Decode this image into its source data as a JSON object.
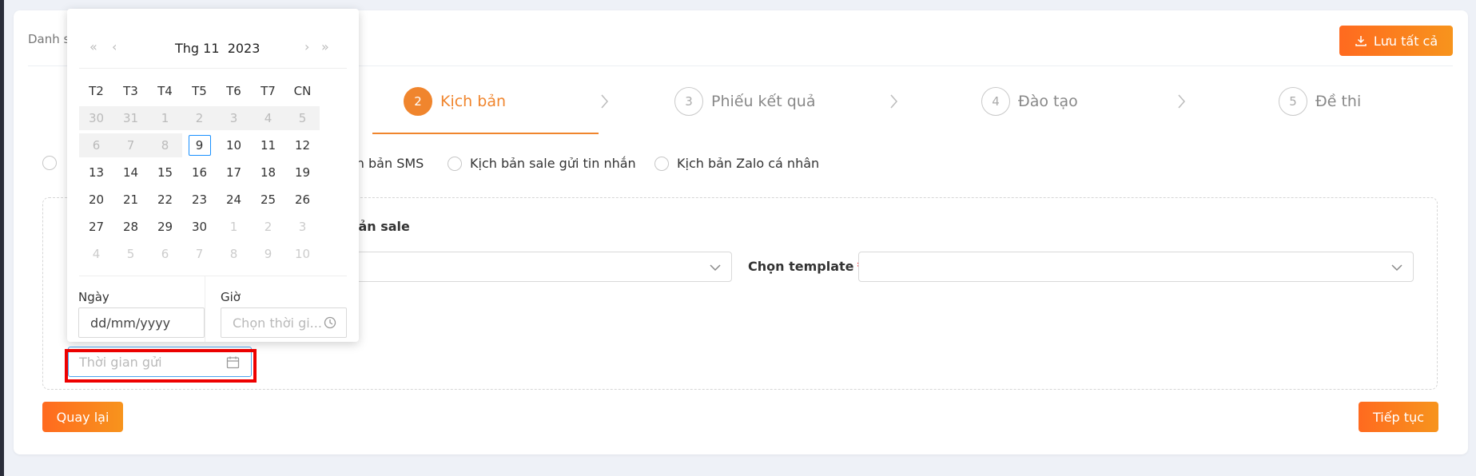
{
  "breadcrumb": "Danh s",
  "toolbar": {
    "save_all_label": "Lưu tất cả"
  },
  "steps": [
    {
      "num": "2",
      "label": "Kịch bản",
      "active": true
    },
    {
      "num": "3",
      "label": "Phiếu kết quả",
      "active": false
    },
    {
      "num": "4",
      "label": "Đào tạo",
      "active": false
    },
    {
      "num": "5",
      "label": "Đề thi",
      "active": false
    }
  ],
  "script_types": [
    {
      "label": "ch bản SMS"
    },
    {
      "label": "Kịch bản sale gửi tin nhắn"
    },
    {
      "label": "Kịch bản Zalo cá nhân"
    }
  ],
  "panel": {
    "title": "bản sale",
    "template_label": "Chọn template",
    "required_mark": "*",
    "send_time_placeholder": "Thời gian gửi"
  },
  "buttons": {
    "back": "Quay lại",
    "next": "Tiếp tục"
  },
  "datepicker": {
    "month_label": "Thg 11",
    "year_label": "2023",
    "weekdays": [
      "T2",
      "T3",
      "T4",
      "T5",
      "T6",
      "T7",
      "CN"
    ],
    "weeks": [
      [
        "30",
        "31",
        "1",
        "2",
        "3",
        "4",
        "5"
      ],
      [
        "6",
        "7",
        "8",
        "9",
        "10",
        "11",
        "12"
      ],
      [
        "13",
        "14",
        "15",
        "16",
        "17",
        "18",
        "19"
      ],
      [
        "20",
        "21",
        "22",
        "23",
        "24",
        "25",
        "26"
      ],
      [
        "27",
        "28",
        "29",
        "30",
        "1",
        "2",
        "3"
      ],
      [
        "4",
        "5",
        "6",
        "7",
        "8",
        "9",
        "10"
      ]
    ],
    "today": "9",
    "date_label": "Ngày",
    "date_value": "dd/mm/yyyy",
    "time_label": "Giờ",
    "time_placeholder": "Chọn thời gi..."
  }
}
